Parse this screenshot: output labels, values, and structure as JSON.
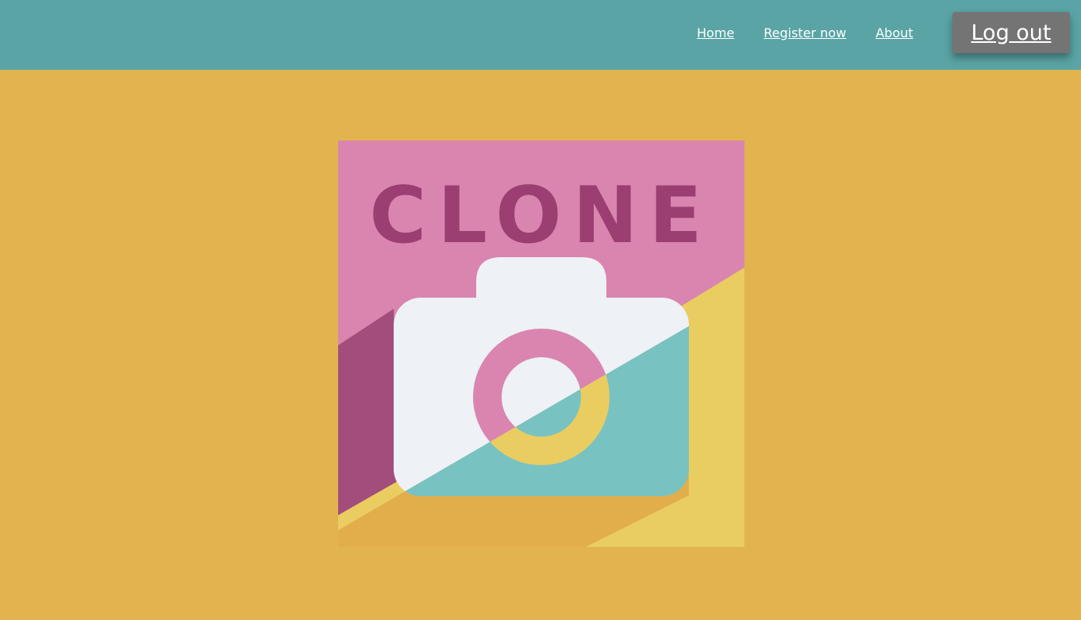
{
  "nav": {
    "home": "Home",
    "register": "Register now",
    "about": "About"
  },
  "logout_label": "Log out",
  "logo": {
    "text": "CLONE",
    "icon": "camera-icon"
  },
  "colors": {
    "page_bg": "#e2b44e",
    "topbar_bg": "#5aa4a5",
    "logout_bg": "#747474",
    "logo_pink": "#d985b0",
    "logo_purple": "#a34d7d",
    "logo_text": "#9b3e72",
    "logo_yellow": "#e9cd60",
    "logo_orange": "#e2ae4c",
    "logo_teal": "#79c2c2",
    "logo_white": "#eef1f5"
  }
}
